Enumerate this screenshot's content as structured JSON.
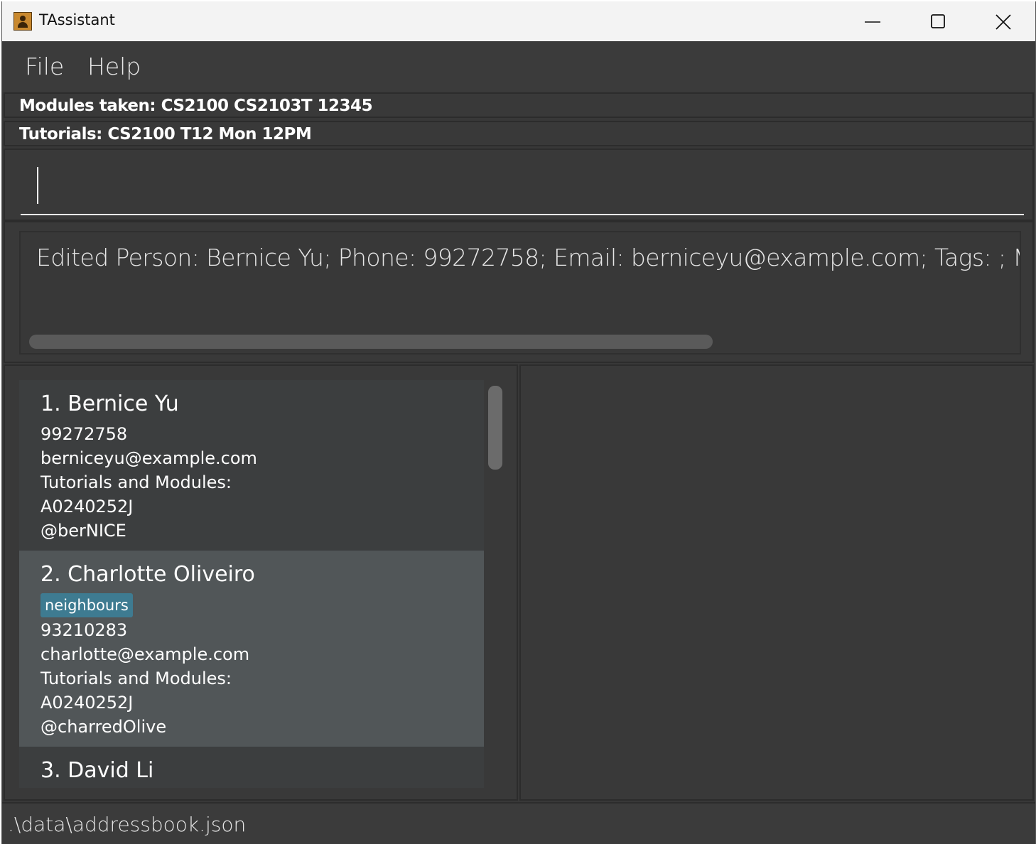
{
  "window": {
    "title": "TAssistant"
  },
  "menu": {
    "file_label": "File",
    "help_label": "Help"
  },
  "info": {
    "modules": "Modules taken: CS2100 CS2103T 12345",
    "tutorials": "Tutorials: CS2100 T12 Mon 12PM"
  },
  "command": {
    "value": "",
    "placeholder": ""
  },
  "result": {
    "text": "Edited Person: Bernice Yu; Phone: 99272758; Email: berniceyu@example.com; Tags: ; Modules: ;"
  },
  "persons": [
    {
      "index_name": "1.  Bernice Yu",
      "phone": "99272758",
      "email": "berniceyu@example.com",
      "tutorials_label": "Tutorials and Modules:",
      "student_id": "A0240252J",
      "telegram": "@berNICE"
    },
    {
      "index_name": "2.  Charlotte Oliveiro",
      "tag": "neighbours",
      "phone": "93210283",
      "email": "charlotte@example.com",
      "tutorials_label": "Tutorials and Modules:",
      "student_id": "A0240252J",
      "telegram": "@charredOlive"
    },
    {
      "index_name": "3.  David Li"
    }
  ],
  "status": {
    "file_path": ".\\data\\addressbook.json"
  },
  "colors": {
    "background": "#383838",
    "selected_card": "#515658",
    "tag": "#3e7b91"
  },
  "icons": [
    "app-icon",
    "minimize-icon",
    "maximize-icon",
    "close-icon"
  ]
}
